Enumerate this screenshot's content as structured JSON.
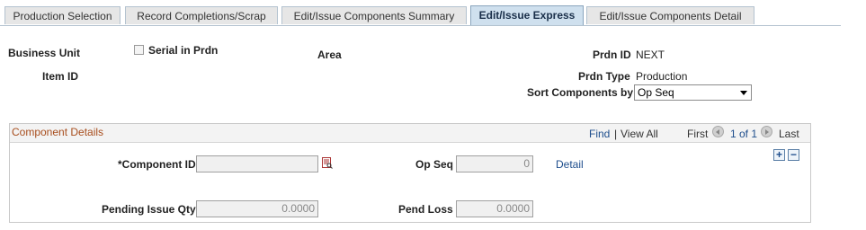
{
  "tabs": [
    {
      "label": "Production Selection",
      "active": false
    },
    {
      "label": "Record Completions/Scrap",
      "active": false
    },
    {
      "label": "Edit/Issue Components Summary",
      "active": false
    },
    {
      "label": "Edit/Issue Express",
      "active": true
    },
    {
      "label": "Edit/Issue Components Detail",
      "active": false
    }
  ],
  "header": {
    "business_unit_label": "Business Unit",
    "serial_in_prdn_label": "Serial in Prdn",
    "area_label": "Area",
    "prdn_id_label": "Prdn ID",
    "prdn_id_value": "NEXT",
    "item_id_label": "Item ID",
    "prdn_type_label": "Prdn Type",
    "prdn_type_value": "Production",
    "sort_components_label": "Sort Components by",
    "sort_components_value": "Op Seq"
  },
  "component_details": {
    "title": "Component Details",
    "find_label": "Find",
    "separator": "|",
    "view_all_label": "View All",
    "first_label": "First",
    "page_indicator": "1 of 1",
    "last_label": "Last",
    "component_id_label": "*Component ID",
    "component_id_value": "",
    "op_seq_label": "Op Seq",
    "op_seq_value": "0",
    "detail_link": "Detail",
    "pending_issue_qty_label": "Pending Issue Qty",
    "pending_issue_qty_value": "0.0000",
    "pend_loss_label": "Pend Loss",
    "pend_loss_value": "0.0000",
    "add_row_symbol": "+",
    "delete_row_symbol": "−"
  },
  "colors": {
    "active_tab_bg": "#cfe0ee",
    "tab_bg": "#e6e6e6",
    "link": "#1d4d8c",
    "section_title": "#a84e1e"
  }
}
